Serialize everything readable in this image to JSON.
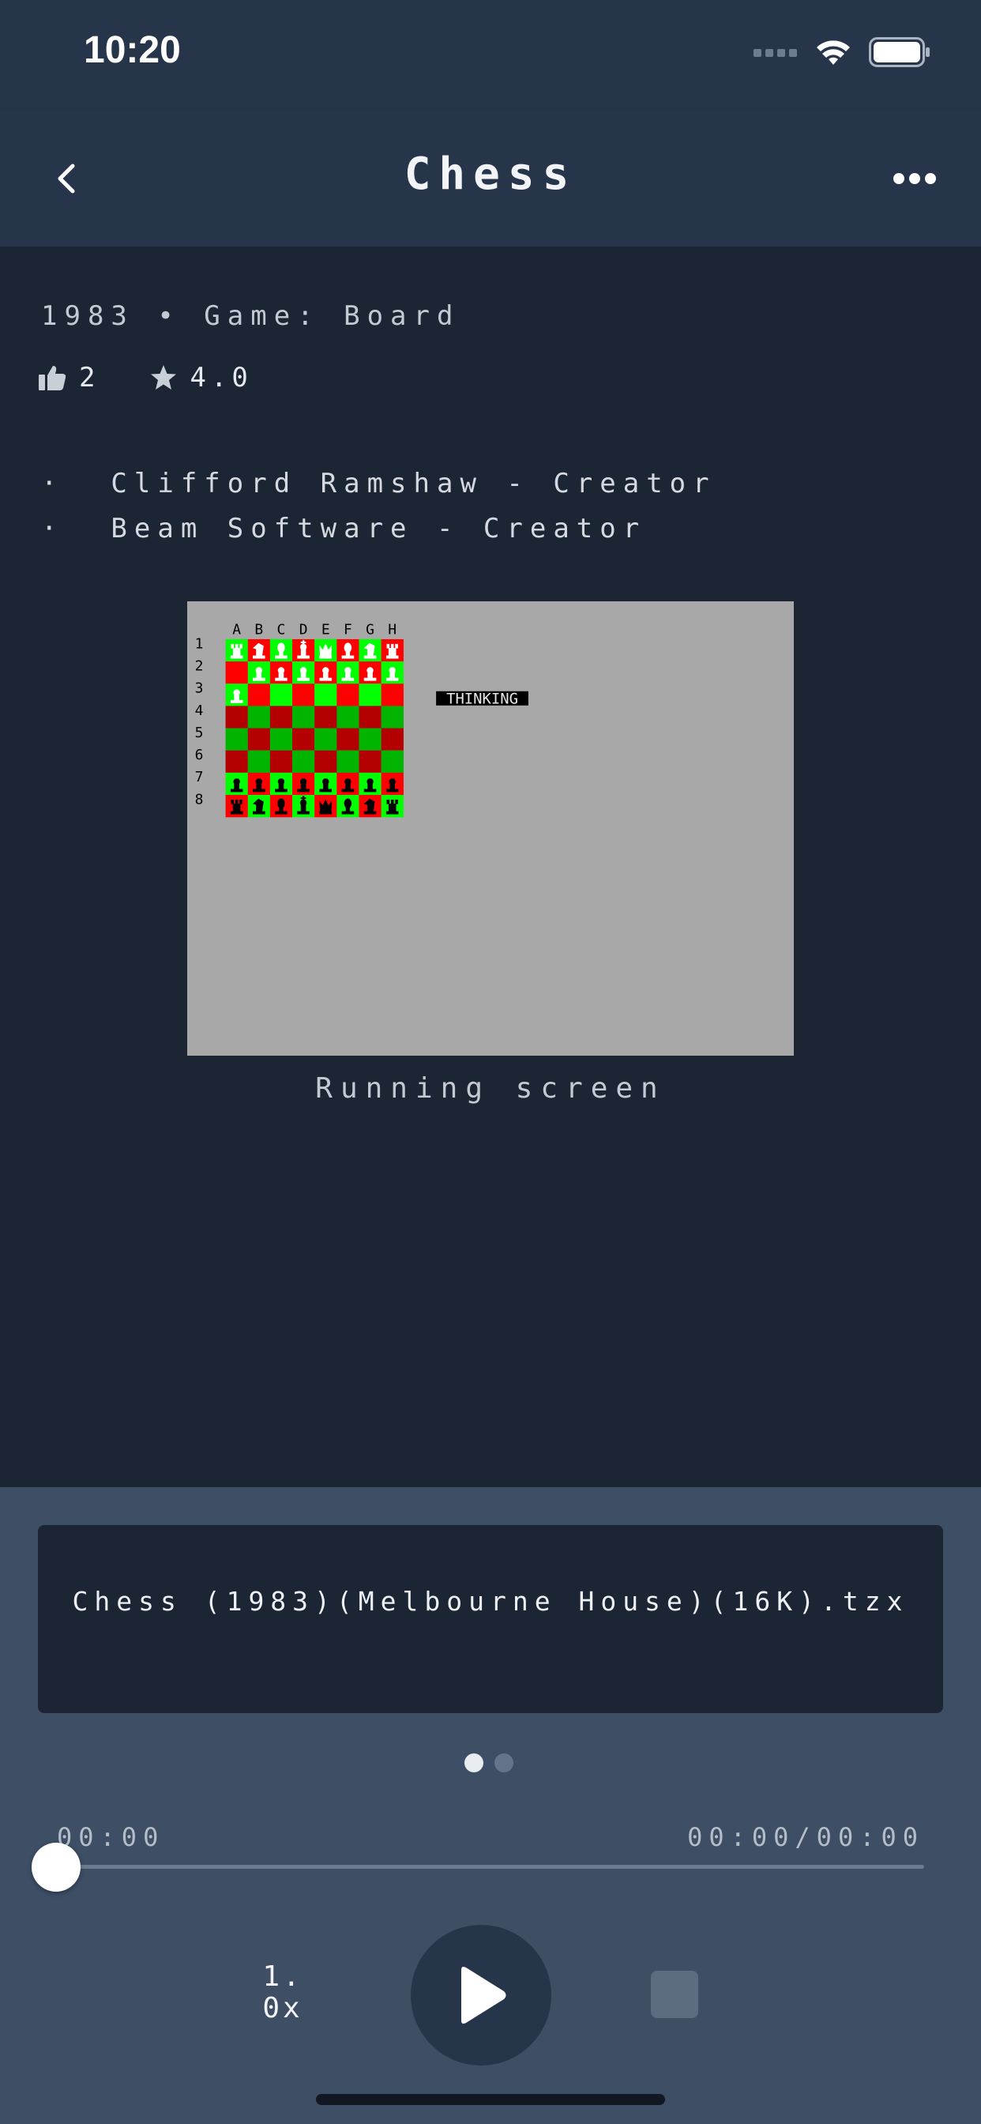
{
  "status_bar": {
    "time": "10:20"
  },
  "nav": {
    "title": "Chess"
  },
  "game": {
    "meta": "1983 • Game: Board",
    "likes": "2",
    "rating": "4.0",
    "credits": [
      "·  Clifford Ramshaw - Creator",
      "·  Beam Software - Creator"
    ],
    "screenshot": {
      "columns": [
        "A",
        "B",
        "C",
        "D",
        "E",
        "F",
        "G",
        "H"
      ],
      "rows": [
        "1",
        "2",
        "3",
        "4",
        "5",
        "6",
        "7",
        "8"
      ],
      "message": "THINKING",
      "caption": "Running screen"
    }
  },
  "player": {
    "track_name": "Chess (1983)(Melbourne House)(16K).tzx",
    "elapsed": "00:00",
    "position": "00:00/00:00",
    "progress": 0,
    "speed": "1.\n0x",
    "page_index": 0,
    "page_count": 2
  },
  "colors": {
    "accent_green": "#00c800",
    "accent_red": "#e00000",
    "background": "#1c2534",
    "player_panel": "#3d4e65"
  }
}
